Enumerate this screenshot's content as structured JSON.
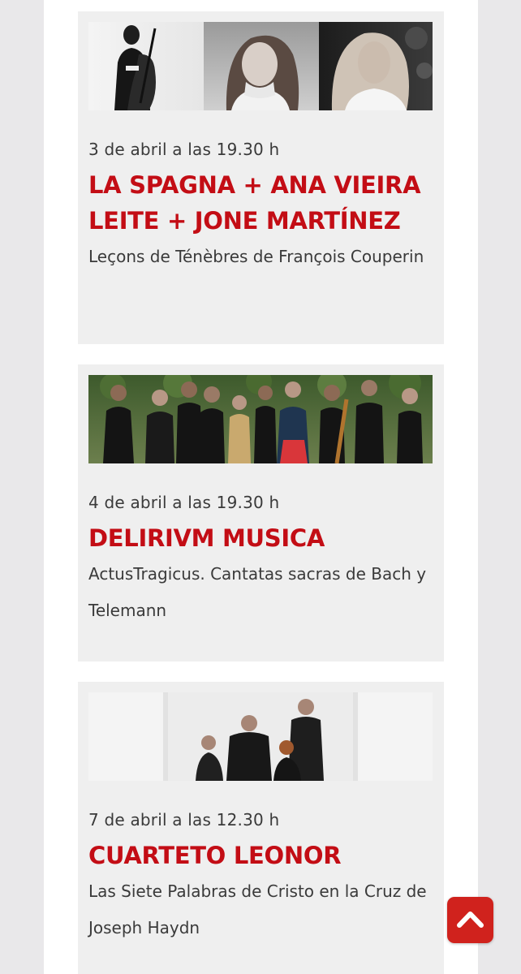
{
  "events": [
    {
      "date": "3 de abril a las 19.30 h",
      "title": "LA SPAGNA + ANA VIEIRA LEITE + JONE MARTÍNEZ",
      "subtitle": "Leçons de Ténèbres de François Couperin"
    },
    {
      "date": "4 de abril a las 19.30 h",
      "title": "DELIRIVM MUSICA",
      "subtitle": "ActusTragicus. Cantatas sacras de Bach y Telemann"
    },
    {
      "date": "7 de abril a las 12.30 h",
      "title": "CUARTETO LEONOR",
      "subtitle": "Las Siete Palabras de Cristo en la Cruz de Joseph Haydn"
    }
  ],
  "colors": {
    "accent": "#c30d15",
    "scroll_button": "#d0221d",
    "card_bg": "#efefef",
    "page_bg": "#e9e8ea"
  },
  "icons": {
    "scroll_top": "chevron-up-icon"
  }
}
